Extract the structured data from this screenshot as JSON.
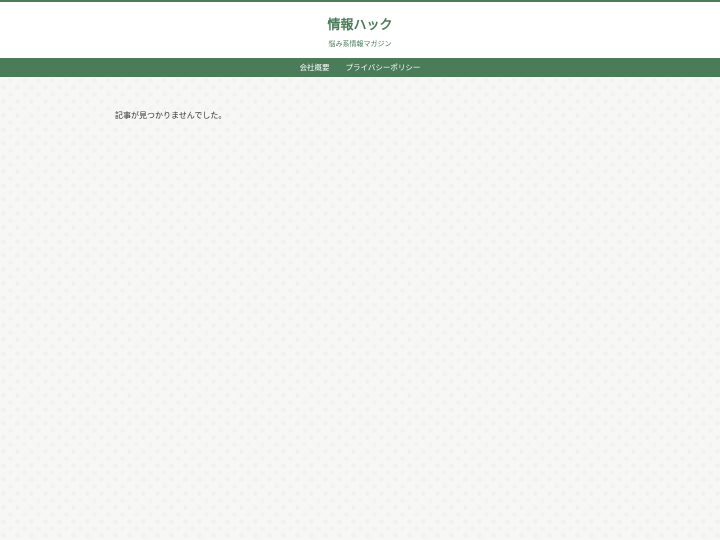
{
  "header": {
    "site_title": "情報ハック",
    "tagline": "悩み系情報マガジン"
  },
  "nav": {
    "items": [
      {
        "label": "会社概要"
      },
      {
        "label": "プライバシーポリシー"
      }
    ]
  },
  "main": {
    "message": "記事が見つかりませんでした。"
  },
  "colors": {
    "accent": "#4a7c59",
    "background": "#f7f7f5"
  }
}
